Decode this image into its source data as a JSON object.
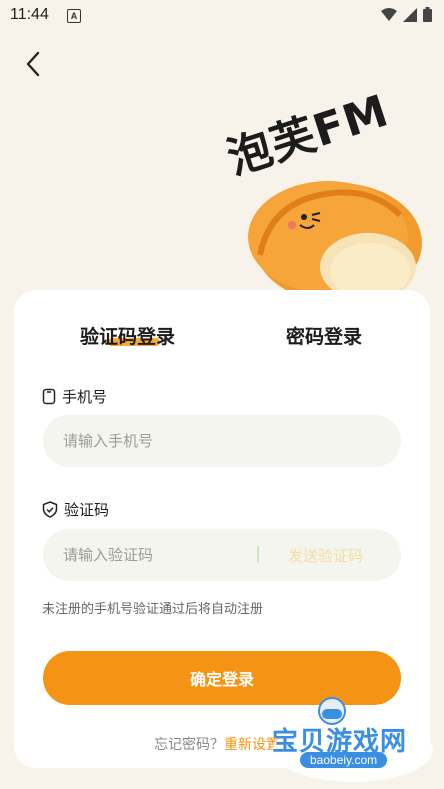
{
  "status": {
    "time": "11:44",
    "notification_glyph": "A"
  },
  "brand": {
    "name": "泡芙FM",
    "accent_color": "#f59414"
  },
  "tabs": [
    {
      "label": "验证码登录",
      "active": true
    },
    {
      "label": "密码登录",
      "active": false
    }
  ],
  "phone": {
    "label": "手机号",
    "placeholder": "请输入手机号",
    "value": ""
  },
  "code": {
    "label": "验证码",
    "placeholder": "请输入验证码",
    "value": "",
    "send_label": "发送验证码"
  },
  "hint": "未注册的手机号验证通过后将自动注册",
  "submit_label": "确定登录",
  "forgot": {
    "question": "忘记密码？",
    "reset_label": "重新设置"
  },
  "watermark": {
    "text": "宝贝游戏网",
    "url": "baobeiy.com"
  }
}
